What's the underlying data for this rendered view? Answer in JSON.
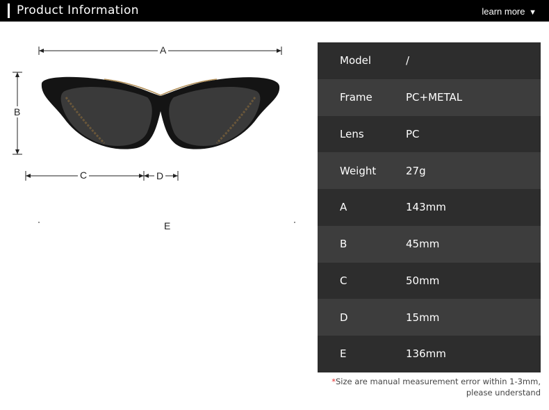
{
  "header": {
    "title": "Product Information",
    "learn_more": "learn more",
    "arrow": "▼"
  },
  "dimensions": {
    "a": "A",
    "b": "B",
    "c": "C",
    "d": "D",
    "e": "E"
  },
  "specs": [
    {
      "key": "Model",
      "value": "/"
    },
    {
      "key": "Frame",
      "value": "PC+METAL"
    },
    {
      "key": "Lens",
      "value": "PC"
    },
    {
      "key": "Weight",
      "value": "27g"
    },
    {
      "key": "A",
      "value": "143mm"
    },
    {
      "key": "B",
      "value": "45mm"
    },
    {
      "key": "C",
      "value": "50mm"
    },
    {
      "key": "D",
      "value": "15mm"
    },
    {
      "key": "E",
      "value": "136mm"
    }
  ],
  "note": {
    "star": "*",
    "text": "Size are manual measurement error within 1-3mm, please understand"
  },
  "colors": {
    "header_bg": "#000000",
    "row_dark": "#2d2d2d",
    "row_light": "#3d3d3d",
    "frame": "#141414",
    "chain_gold": "#c9a66b"
  },
  "icons": [
    "chevron-down-icon"
  ]
}
